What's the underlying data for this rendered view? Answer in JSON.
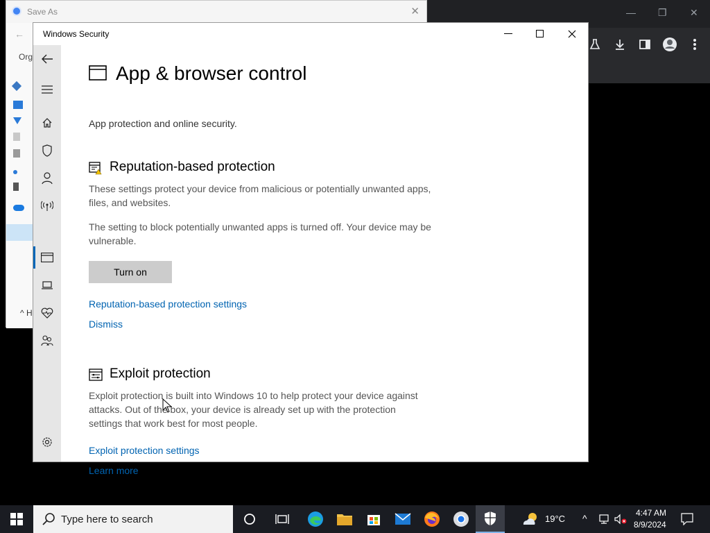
{
  "background_chrome": {
    "controls": [
      "—",
      "❐",
      "✕"
    ],
    "toolbar_icons": [
      "flask-icon",
      "download-icon",
      "sidepanel-icon",
      "profile-icon",
      "more-icon"
    ]
  },
  "save_as": {
    "title": "Save As",
    "organize": "Orga",
    "hide_folders": "H"
  },
  "windows_security": {
    "title": "Windows Security",
    "page": {
      "title": "App & browser control",
      "subtitle": "App protection and online security."
    },
    "reputation": {
      "title": "Reputation-based protection",
      "desc": "These settings protect your device from malicious or potentially unwanted apps, files, and websites.",
      "warning": "The setting to block potentially unwanted apps is turned off. Your device may be vulnerable.",
      "button": "Turn on",
      "settings_link": "Reputation-based protection settings",
      "dismiss_link": "Dismiss"
    },
    "exploit": {
      "title": "Exploit protection",
      "desc": "Exploit protection is built into Windows 10 to help protect your device against attacks.  Out of the box, your device is already set up with the protection settings that work best for most people.",
      "settings_link": "Exploit protection settings",
      "learn_more": "Learn more"
    }
  },
  "taskbar": {
    "search_placeholder": "Type here to search",
    "temperature": "19°C",
    "time": "4:47 AM",
    "date": "8/9/2024"
  },
  "colors": {
    "accent": "#0063b1",
    "sidebar": "#e6e6e6",
    "taskbar": "#1a1c22"
  }
}
